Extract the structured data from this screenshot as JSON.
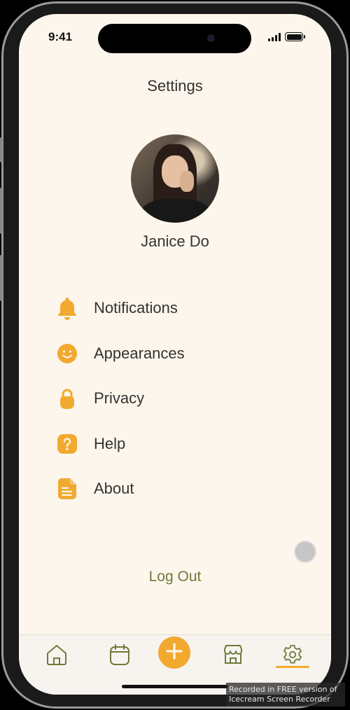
{
  "status_bar": {
    "time": "9:41"
  },
  "header": {
    "title": "Settings"
  },
  "profile": {
    "name": "Janice Do"
  },
  "menu": [
    {
      "label": "Notifications",
      "icon": "bell-icon"
    },
    {
      "label": "Appearances",
      "icon": "smiley-icon"
    },
    {
      "label": "Privacy",
      "icon": "lock-icon"
    },
    {
      "label": "Help",
      "icon": "question-icon"
    },
    {
      "label": "About",
      "icon": "document-icon"
    }
  ],
  "logout_label": "Log Out",
  "tabs": [
    {
      "icon": "home-icon"
    },
    {
      "icon": "calendar-icon"
    },
    {
      "icon": "plus-icon"
    },
    {
      "icon": "store-icon"
    },
    {
      "icon": "gear-icon",
      "active": true
    }
  ],
  "colors": {
    "accent": "#f2a92f",
    "background": "#fdf6ec",
    "logout": "#6d7a3a",
    "tab_icon": "#6d7a3a"
  },
  "watermark": {
    "line1": "Recorded in FREE version of",
    "line2": "Icecream  Screen  Recorder"
  }
}
